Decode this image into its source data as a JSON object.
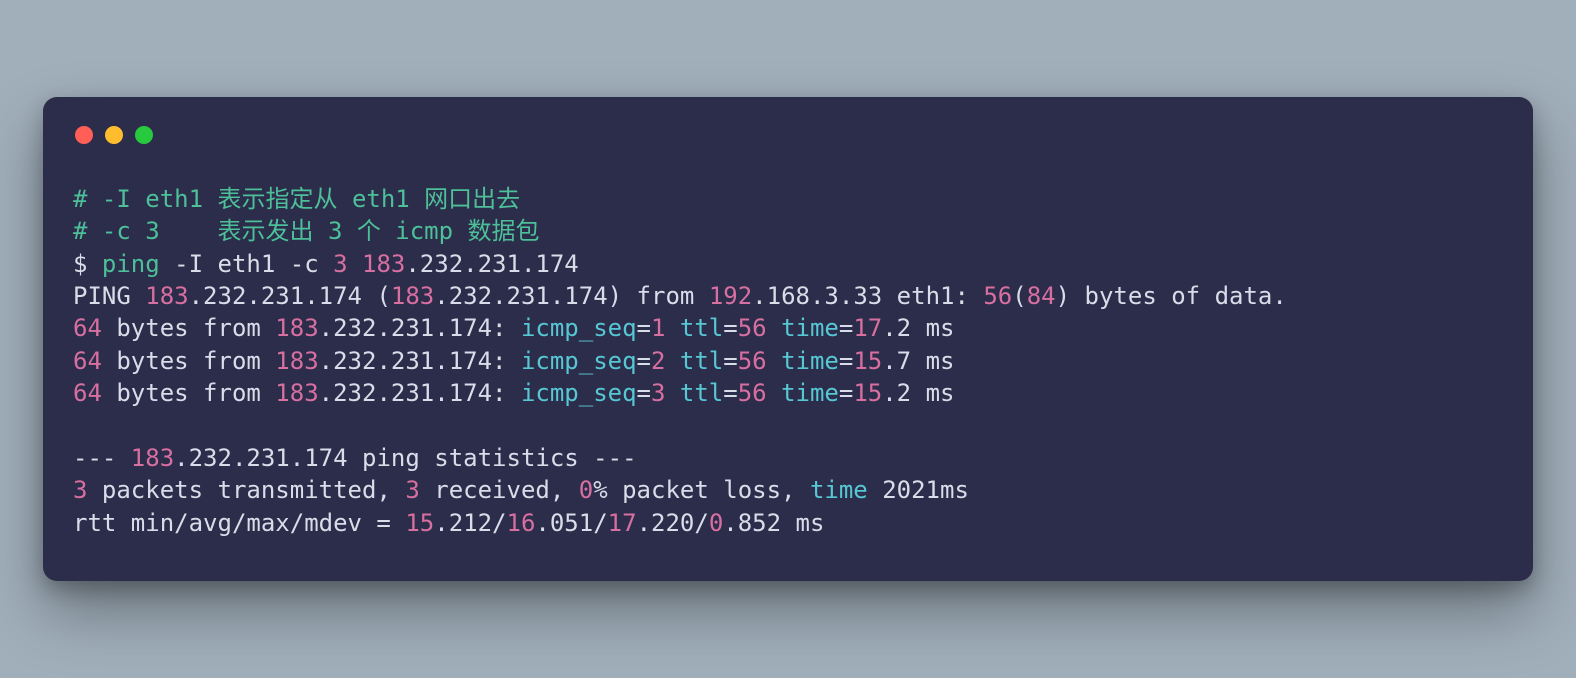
{
  "colors": {
    "bg_page": "#a1afbb",
    "bg_window": "#2b2d4a",
    "dot_red": "#ff5f56",
    "dot_yellow": "#ffbd2e",
    "dot_green": "#27c93f",
    "txt_green": "#4dbf99",
    "txt_pink": "#d86fa1",
    "txt_cyan": "#57c7d4",
    "txt_plain": "#d8dee9"
  },
  "l1": {
    "a": "# -I eth1 表示指定从 eth1 网口出去"
  },
  "l2": {
    "a": "# -c 3    表示发出 3 个 icmp 数据包"
  },
  "l3": {
    "a": "$ ",
    "b": "ping ",
    "c": "-I eth1 -c ",
    "d": "3 183",
    "e": ".232.231.174"
  },
  "l4": {
    "a": "PING ",
    "b": "183",
    "c": ".232.231.174 (",
    "d": "183",
    "e": ".232.231.174) from ",
    "f": "192",
    "g": ".168.3.33 eth1: ",
    "h": "56",
    "i": "(",
    "j": "84",
    "k": ") bytes of data."
  },
  "l5": {
    "a": "64",
    "b": " bytes from ",
    "c": "183",
    "d": ".232.231.174: ",
    "e": "icmp_seq",
    "f": "=",
    "g": "1 ",
    "h": "ttl",
    "i": "=",
    "j": "56 ",
    "k": "time",
    "l": "=",
    "m": "17",
    "n": ".2 ms"
  },
  "l6": {
    "a": "64",
    "b": " bytes from ",
    "c": "183",
    "d": ".232.231.174: ",
    "e": "icmp_seq",
    "f": "=",
    "g": "2 ",
    "h": "ttl",
    "i": "=",
    "j": "56 ",
    "k": "time",
    "l": "=",
    "m": "15",
    "n": ".7 ms"
  },
  "l7": {
    "a": "64",
    "b": " bytes from ",
    "c": "183",
    "d": ".232.231.174: ",
    "e": "icmp_seq",
    "f": "=",
    "g": "3 ",
    "h": "ttl",
    "i": "=",
    "j": "56 ",
    "k": "time",
    "l": "=",
    "m": "15",
    "n": ".2 ms"
  },
  "l8": {
    "a": ""
  },
  "l9": {
    "a": "--- ",
    "b": "183",
    "c": ".232.231.174 ping statistics ---"
  },
  "l10": {
    "a": "3",
    "b": " packets transmitted, ",
    "c": "3",
    "d": " received, ",
    "e": "0",
    "f": "% packet loss, ",
    "g": "time",
    "h": " 2021ms"
  },
  "l11": {
    "a": "rtt min/avg/max/mdev = ",
    "b": "15",
    "c": ".212/",
    "d": "16",
    "e": ".051/",
    "f": "17",
    "g": ".220/",
    "h": "0",
    "i": ".852 ms"
  }
}
